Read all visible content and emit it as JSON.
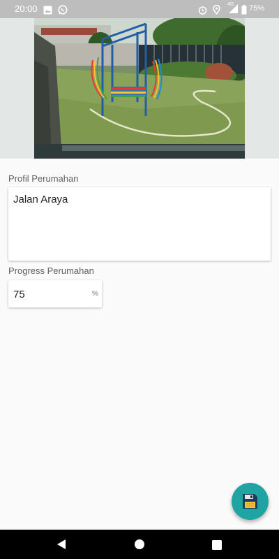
{
  "status_bar": {
    "time": "20:00",
    "battery_text": "75%",
    "network_label": "4G",
    "icons": [
      "gallery-icon",
      "whatsapp-icon",
      "alarm-icon",
      "location-icon",
      "signal-icon",
      "battery-icon"
    ]
  },
  "photo": {
    "description_icon": "playground-photo"
  },
  "form": {
    "profile_label": "Profil Perumahan",
    "profile_value": "Jalan Araya",
    "progress_label": "Progress Perumahan",
    "progress_value": "75",
    "progress_unit": "%"
  },
  "fab": {
    "icon": "save-icon",
    "color": "#1ea4a2"
  },
  "nav_bar": {
    "icons": [
      "back-icon",
      "home-icon",
      "recents-icon"
    ]
  }
}
